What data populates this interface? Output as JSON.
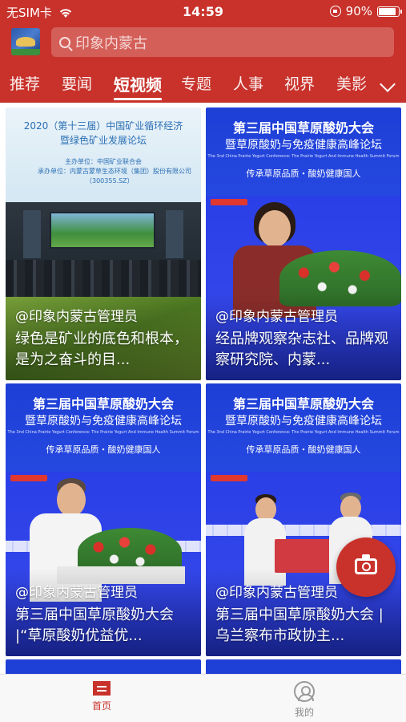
{
  "status_bar": {
    "carrier": "无SIM卡",
    "time": "14:59",
    "battery": "90%",
    "battery_level": 0.9
  },
  "search": {
    "placeholder": "印象内蒙古"
  },
  "tabs": [
    {
      "label": "推荐"
    },
    {
      "label": "要闻"
    },
    {
      "label": "短视频"
    },
    {
      "label": "专题"
    },
    {
      "label": "人事"
    },
    {
      "label": "视界"
    },
    {
      "label": "美影"
    }
  ],
  "active_tab": "短视频",
  "cards": [
    {
      "author": "@印象内蒙古管理员",
      "title": "绿色是矿业的底色和根本，是为之奋斗的目...",
      "thumb_heading1": "2020（第十三届）中国矿业循环经济",
      "thumb_heading2": "暨绿色矿业发展论坛",
      "thumb_line1": "主办单位：中国矿业联合会",
      "thumb_line2": "承办单位：内蒙古蒙草生态环境（集团）股份有限公司",
      "thumb_line3": "（300355.SZ）"
    },
    {
      "author": "@印象内蒙古管理员",
      "title": "经品牌观察杂志社、品牌观察研究院、内蒙...",
      "thumb_heading1": "第三届中国草原酸奶大会",
      "thumb_heading2": "暨草原酸奶与免疫健康高峰论坛",
      "thumb_english": "The 3nd China Prairie Yogurt Conference: The Prairie Yogurt And Immune Health Summit Forum",
      "thumb_slogan": "传承草原品质・酸奶健康国人"
    },
    {
      "author": "@印象内蒙古管理员",
      "title": "第三届中国草原酸奶大会 |“草原酸奶优益优...",
      "thumb_heading1": "第三届中国草原酸奶大会",
      "thumb_heading2": "暨草原酸奶与免疫健康高峰论坛",
      "thumb_english": "The 3nd China Prairie Yogurt Conference: The Prairie Yogurt And Immune Health Summit Forum",
      "thumb_slogan": "传承草原品质・酸奶健康国人"
    },
    {
      "author": "@印象内蒙古管理员",
      "title": "第三届中国草原酸奶大会 | 乌兰察布市政协主...",
      "thumb_heading1": "第三届中国草原酸奶大会",
      "thumb_heading2": "暨草原酸奶与免疫健康高峰论坛",
      "thumb_english": "The 3nd China Prairie Yogurt Conference: The Prairie Yogurt And Immune Health Summit Forum",
      "thumb_slogan": "传承草原品质・酸奶健康国人"
    }
  ],
  "bottom_nav": {
    "home": "首页",
    "me": "我的"
  },
  "icons": {
    "search": "search-icon",
    "more_tabs": "chevron-down-icon",
    "camera": "camera-icon",
    "home": "home-icon",
    "me": "user-icon"
  },
  "colors": {
    "brand_red": "#c8322b",
    "yogurt_blue": "#2548e0",
    "inactive_gray": "#8a8a8a"
  }
}
